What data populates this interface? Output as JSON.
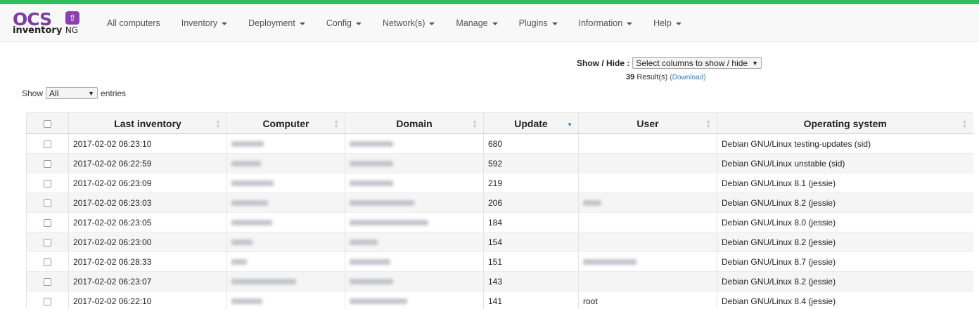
{
  "brand": {
    "logo_top": "OCS",
    "logo_bottom": "inventory",
    "logo_suffix": "NG",
    "accent": "#2fbf5f"
  },
  "nav": [
    {
      "label": "All computers",
      "dropdown": false
    },
    {
      "label": "Inventory",
      "dropdown": true
    },
    {
      "label": "Deployment",
      "dropdown": true
    },
    {
      "label": "Config",
      "dropdown": true
    },
    {
      "label": "Network(s)",
      "dropdown": true
    },
    {
      "label": "Manage",
      "dropdown": true
    },
    {
      "label": "Plugins",
      "dropdown": true
    },
    {
      "label": "Information",
      "dropdown": true
    },
    {
      "label": "Help",
      "dropdown": true
    }
  ],
  "showhide": {
    "label": "Show / Hide :",
    "select_value": "Select columns to show / hide"
  },
  "results": {
    "count": "39",
    "label": "Result(s)",
    "download": "(Download)"
  },
  "entries": {
    "prefix": "Show",
    "value": "All",
    "suffix": "entries"
  },
  "table": {
    "columns": [
      "Last inventory",
      "Computer",
      "Domain",
      "Update",
      "User",
      "Operating system"
    ],
    "rows": [
      {
        "last": "2017-02-02 06:23:10",
        "update": "680",
        "os": "Debian GNU/Linux testing-updates (sid)"
      },
      {
        "last": "2017-02-02 06:22:59",
        "update": "592",
        "os": "Debian GNU/Linux unstable (sid)"
      },
      {
        "last": "2017-02-02 06:23:09",
        "update": "219",
        "os": "Debian GNU/Linux 8.1 (jessie)"
      },
      {
        "last": "2017-02-02 06:23:03",
        "update": "206",
        "os": "Debian GNU/Linux 8.2 (jessie)"
      },
      {
        "last": "2017-02-02 06:23:05",
        "update": "184",
        "os": "Debian GNU/Linux 8.0 (jessie)"
      },
      {
        "last": "2017-02-02 06:23:00",
        "update": "154",
        "os": "Debian GNU/Linux 8.2 (jessie)"
      },
      {
        "last": "2017-02-02 06:28:33",
        "update": "151",
        "os": "Debian GNU/Linux 8.7 (jessie)"
      },
      {
        "last": "2017-02-02 06:23:07",
        "update": "143",
        "os": "Debian GNU/Linux 8.2 (jessie)"
      },
      {
        "last": "2017-02-02 06:22:10",
        "update": "141",
        "user": "root",
        "os": "Debian GNU/Linux 8.4 (jessie)"
      }
    ]
  }
}
